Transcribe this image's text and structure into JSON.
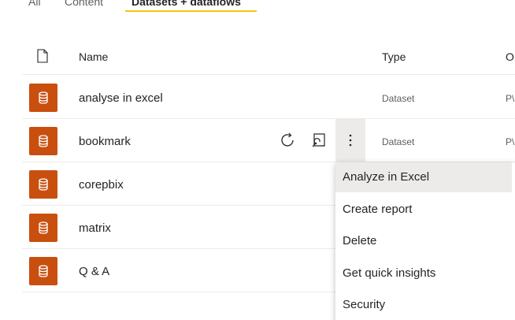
{
  "tabs": [
    {
      "label": "All"
    },
    {
      "label": "Content"
    },
    {
      "label": "Datasets + dataflows",
      "active": true
    }
  ],
  "colors": {
    "accent_underline": "#f2c811",
    "dataset_icon_bg": "#c94f0f",
    "row_divider": "#edebe9"
  },
  "table": {
    "header_icon": "file-icon",
    "columns": {
      "name": "Name",
      "type": "Type",
      "owner": "O"
    },
    "rows": [
      {
        "icon": "dataset-icon",
        "name": "analyse in excel",
        "type": "Dataset",
        "owner": "P\\"
      },
      {
        "icon": "dataset-icon",
        "name": "bookmark",
        "type": "Dataset",
        "owner": "P\\",
        "hovered": true
      },
      {
        "icon": "dataset-icon",
        "name": "corepbix",
        "type": "",
        "owner": ""
      },
      {
        "icon": "dataset-icon",
        "name": "matrix",
        "type": "",
        "owner": ""
      },
      {
        "icon": "dataset-icon",
        "name": "Q & A",
        "type": "",
        "owner": ""
      }
    ]
  },
  "row_actions": {
    "refresh_icon": "refresh-icon",
    "schedule_icon": "schedule-refresh-icon",
    "more_icon": "more-options-icon"
  },
  "context_menu": {
    "items": [
      {
        "label": "Analyze in Excel",
        "highlighted": true
      },
      {
        "label": "Create report"
      },
      {
        "label": "Delete"
      },
      {
        "label": "Get quick insights"
      },
      {
        "label": "Security"
      }
    ]
  }
}
